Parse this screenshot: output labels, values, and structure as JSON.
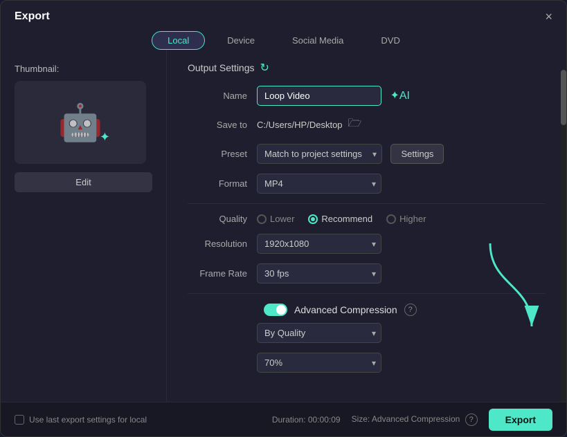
{
  "dialog": {
    "title": "Export",
    "close_label": "×"
  },
  "tabs": [
    {
      "id": "local",
      "label": "Local",
      "active": true
    },
    {
      "id": "device",
      "label": "Device",
      "active": false
    },
    {
      "id": "social-media",
      "label": "Social Media",
      "active": false
    },
    {
      "id": "dvd",
      "label": "DVD",
      "active": false
    }
  ],
  "left_panel": {
    "thumbnail_label": "Thumbnail:",
    "edit_btn_label": "Edit"
  },
  "right_panel": {
    "output_settings_label": "Output Settings",
    "name_label": "Name",
    "name_value": "Loop Video",
    "save_to_label": "Save to",
    "save_path": "C:/Users/HP/Desktop",
    "preset_label": "Preset",
    "preset_value": "Match to project settings",
    "settings_btn_label": "Settings",
    "format_label": "Format",
    "format_value": "MP4",
    "quality_label": "Quality",
    "quality_options": [
      {
        "id": "lower",
        "label": "Lower",
        "selected": false
      },
      {
        "id": "recommend",
        "label": "Recommend",
        "selected": true
      },
      {
        "id": "higher",
        "label": "Higher",
        "selected": false
      }
    ],
    "resolution_label": "Resolution",
    "resolution_value": "1920x1080",
    "frame_rate_label": "Frame Rate",
    "frame_rate_value": "30 fps",
    "adv_compression_label": "Advanced Compression",
    "by_quality_label": "By Quality",
    "quality_pct_label": "70%"
  },
  "bottom_bar": {
    "checkbox_label": "Use last export settings for local",
    "duration_label": "Duration: 00:00:09",
    "size_label": "Size: Advanced Compression",
    "export_btn_label": "Export"
  }
}
